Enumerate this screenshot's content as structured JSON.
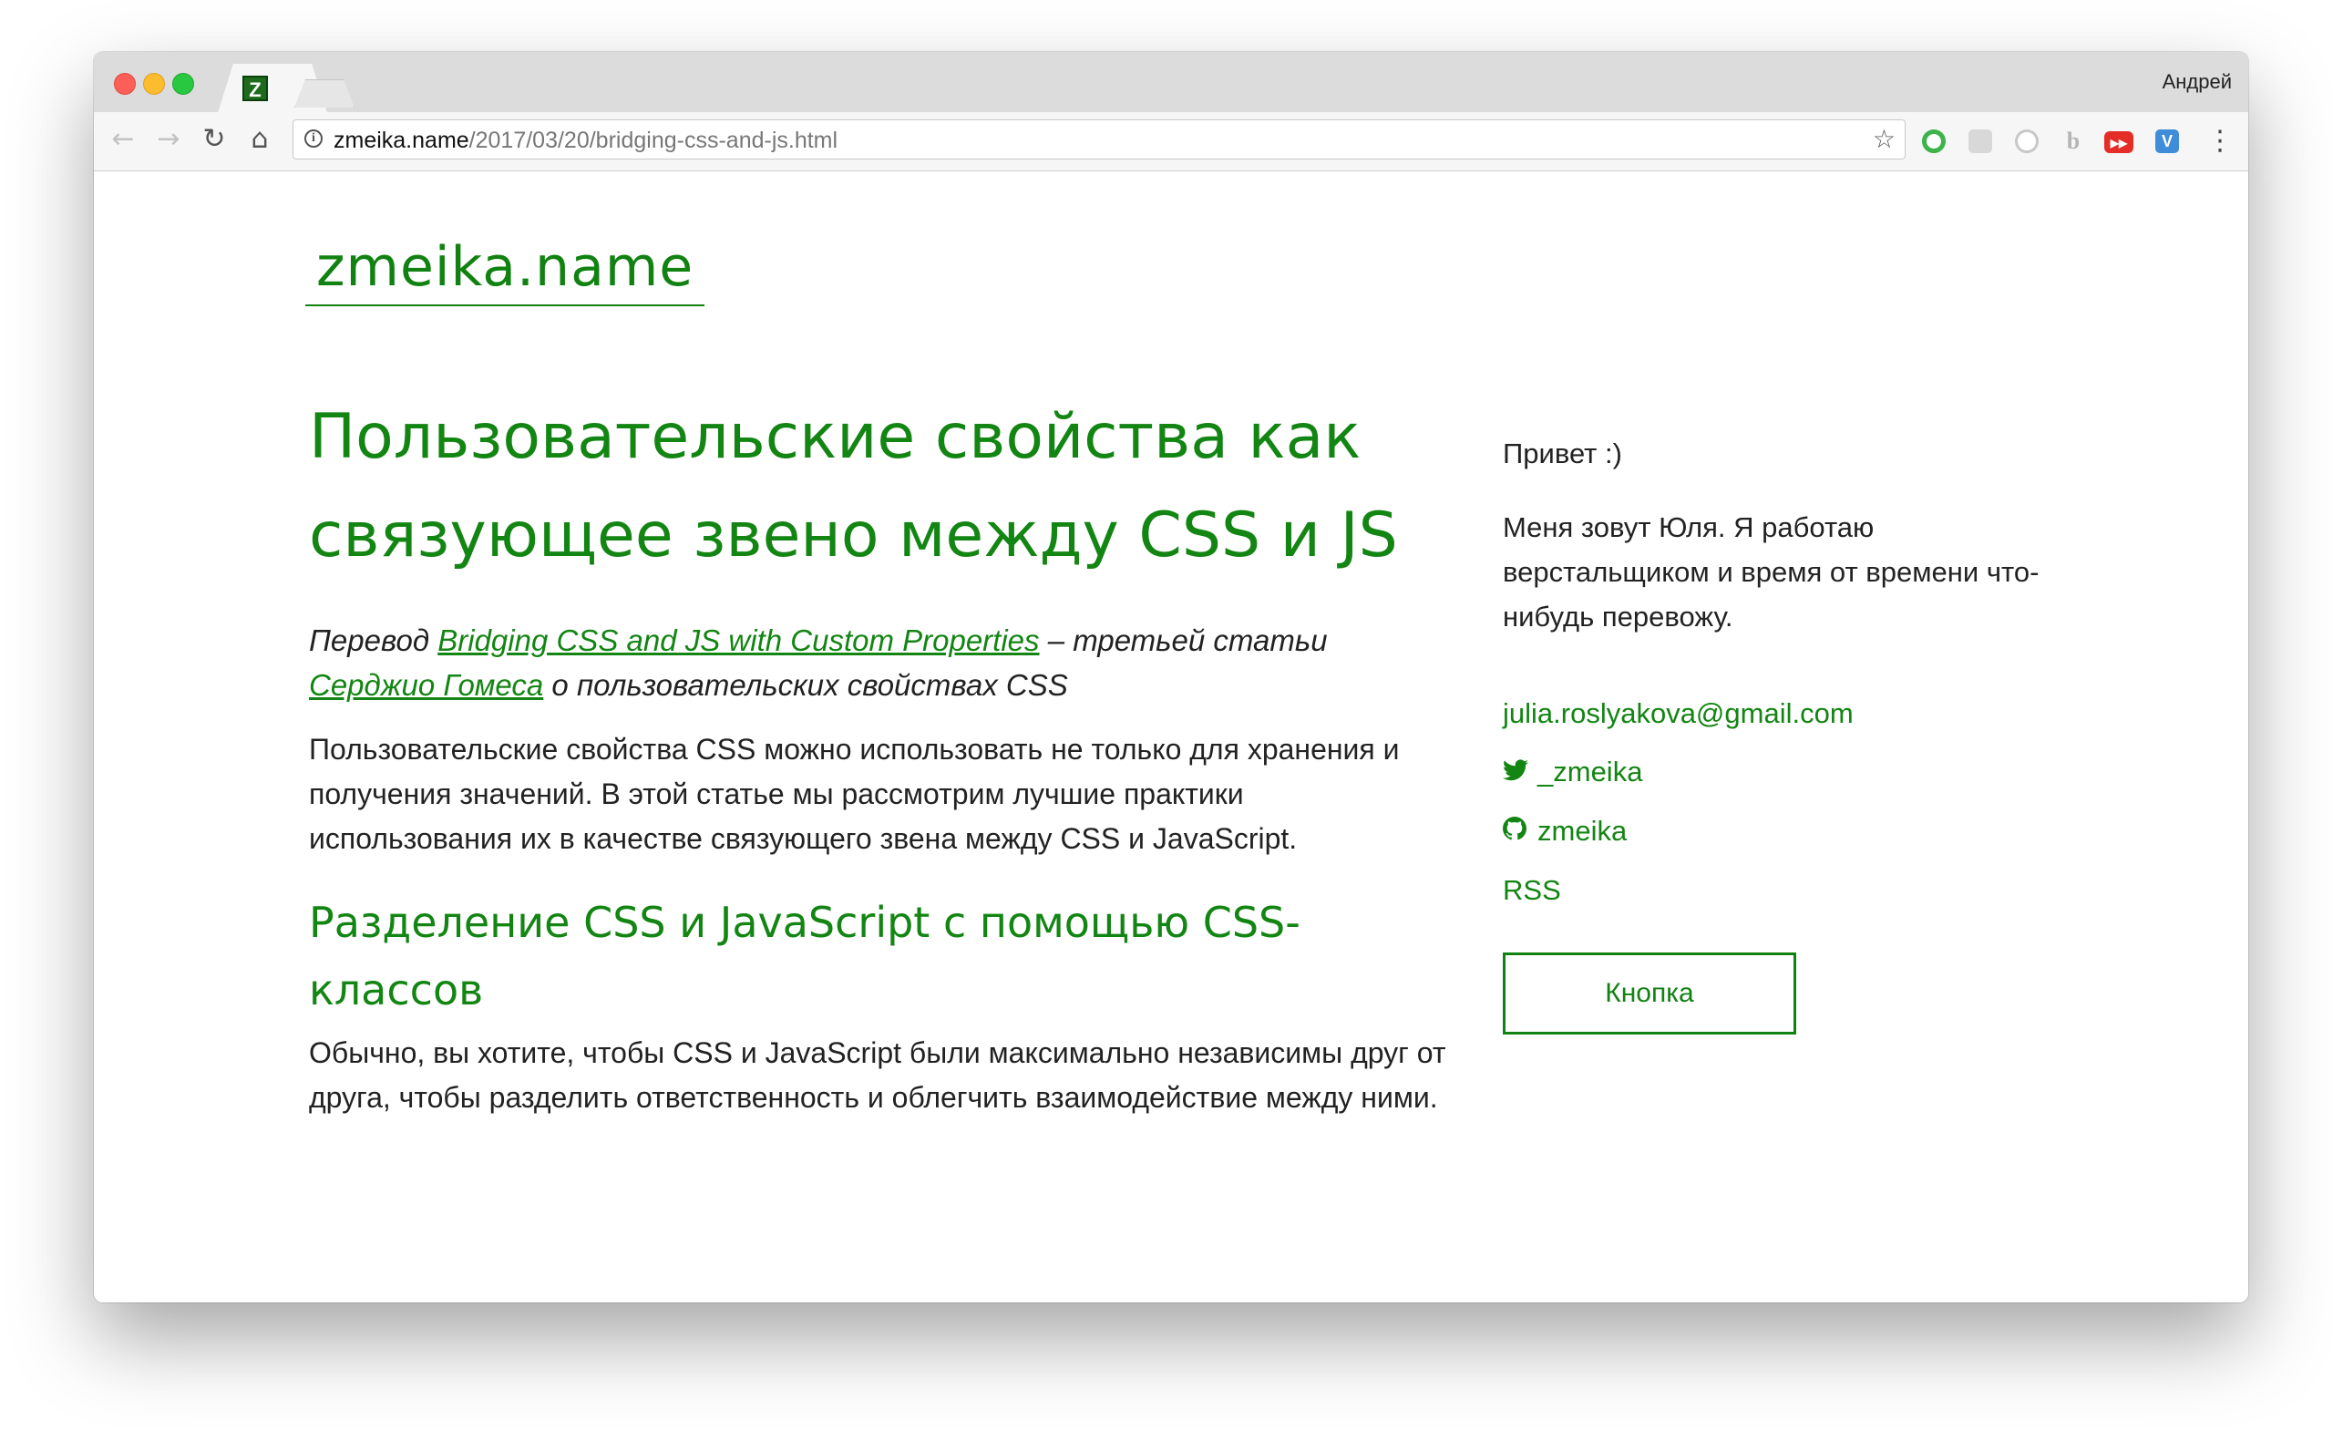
{
  "browser": {
    "tab_favicon": "Z",
    "profile_name": "Андрей",
    "url_host": "zmeika.name",
    "url_path": "/2017/03/20/bridging-css-and-js.html",
    "icons": {
      "back": "←",
      "forward": "→",
      "reload": "↻",
      "home": "⌂",
      "star": "☆",
      "menu": "⋮"
    },
    "extensions": [
      "",
      "",
      "",
      "b",
      "▶▶",
      "V"
    ]
  },
  "site": {
    "brand": "zmeika.name"
  },
  "article": {
    "title": "Пользовательские свойства как связующее звено между CSS и JS",
    "intro_prefix": "Перевод ",
    "intro_link1": "Bridging CSS and JS with Custom Properties",
    "intro_mid": " – третьей статьи ",
    "intro_link2": "Серджио Гомеса",
    "intro_suffix": " о пользовательских свойствах CSS",
    "paragraph1": "Пользовательские свойства CSS можно использовать не только для хранения и получения значений. В этой статье мы рассмотрим лучшие практики использования их в качестве связующего звена между CSS и JavaScript.",
    "section_title": "Разделение CSS и JavaScript с помощью CSS-классов",
    "paragraph2": "Обычно, вы хотите, чтобы CSS и JavaScript были максимально независимы друг от друга, чтобы разделить ответственность и облегчить взаимодействие между ними."
  },
  "sidebar": {
    "greeting": "Привет :)",
    "about": "Меня зовут Юля. Я работаю верстальщиком и время от времени что-нибудь перевожу.",
    "email": "julia.roslyakova@gmail.com",
    "twitter": "_zmeika",
    "github": "zmeika",
    "rss": "RSS",
    "button_label": "Кнопка"
  },
  "colors": {
    "accent": "#138513"
  }
}
